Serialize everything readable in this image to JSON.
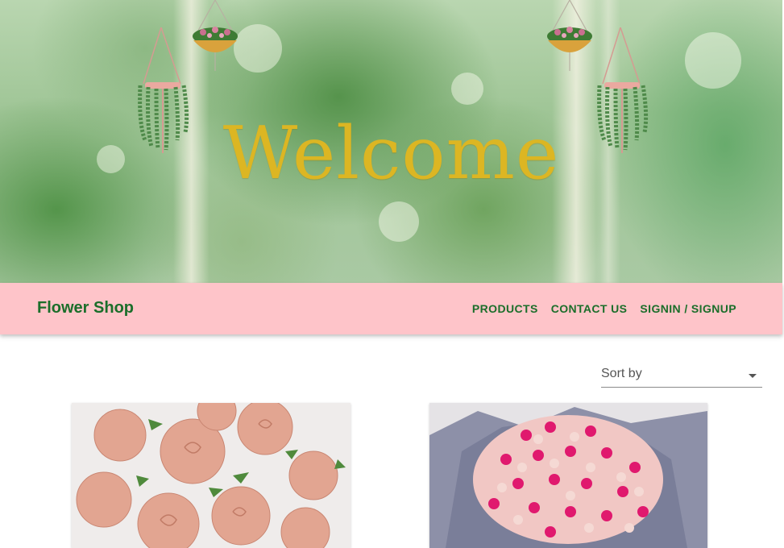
{
  "hero": {
    "headline": "Welcome"
  },
  "navbar": {
    "brand": "Flower Shop",
    "links": [
      "PRODUCTS",
      "CONTACT US",
      "SIGNIN / SIGNUP"
    ]
  },
  "sort": {
    "label": "Sort by"
  },
  "products": [
    {
      "image": "peach-roses-bouquet"
    },
    {
      "image": "pink-roses-bouquet-grey-wrap"
    }
  ],
  "colors": {
    "navbar_bg": "#fec4c9",
    "brand_green": "#1b6e2a",
    "headline_gold": "#dcb623"
  }
}
